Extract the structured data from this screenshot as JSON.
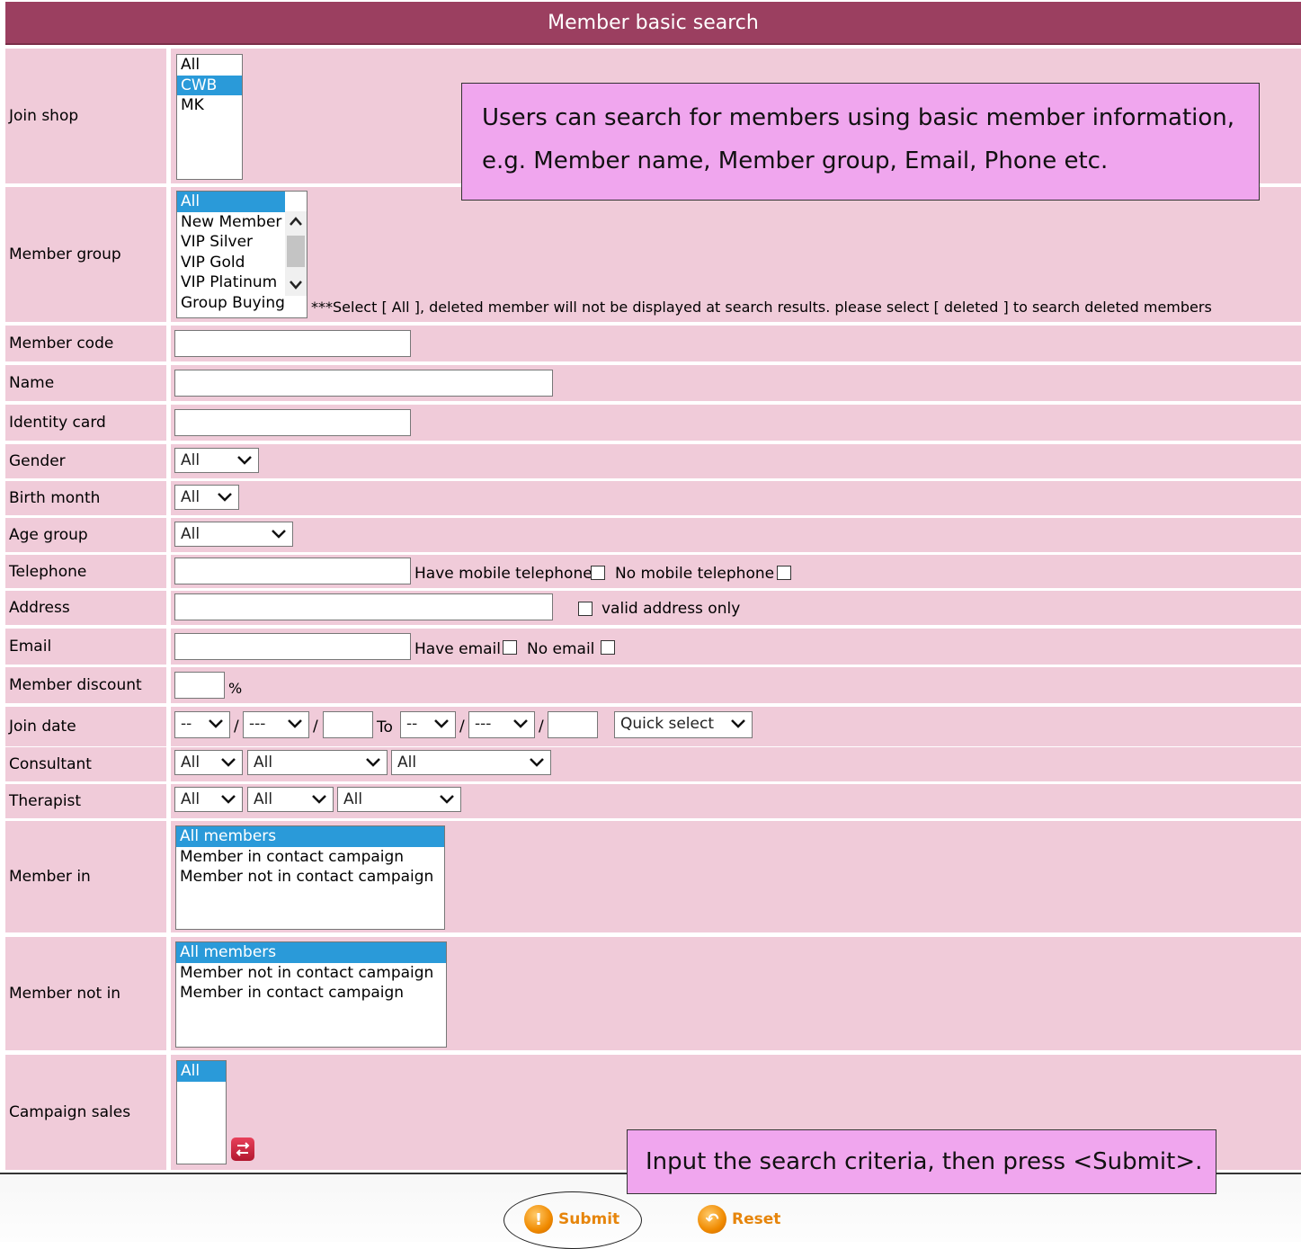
{
  "header": {
    "title": "Member basic search"
  },
  "join_shop": {
    "label": "Join shop",
    "options": [
      "All",
      "CWB",
      "MK"
    ],
    "selected": "CWB"
  },
  "member_group": {
    "label": "Member group",
    "options": [
      "All",
      "New Member",
      "VIP Silver",
      "VIP Gold",
      "VIP Platinum",
      "Group Buying"
    ],
    "selected": "All",
    "note": "***Select [ All ], deleted member will not be displayed at search results. please select [ deleted ] to search deleted members"
  },
  "member_code": {
    "label": "Member code",
    "value": ""
  },
  "name": {
    "label": "Name",
    "value": ""
  },
  "identity_card": {
    "label": "Identity card",
    "value": ""
  },
  "gender": {
    "label": "Gender",
    "value": "All"
  },
  "birth_month": {
    "label": "Birth month",
    "value": "All"
  },
  "age_group": {
    "label": "Age group",
    "value": "All"
  },
  "telephone": {
    "label": "Telephone",
    "value": "",
    "have_mobile": "Have mobile telephone",
    "no_mobile": "No mobile telephone"
  },
  "address": {
    "label": "Address",
    "value": "",
    "valid_only": "valid address only"
  },
  "email": {
    "label": "Email",
    "value": "",
    "have_email": "Have email",
    "no_email": "No email"
  },
  "member_discount": {
    "label": "Member discount",
    "value": "",
    "unit": "%"
  },
  "join_date": {
    "label": "Join date",
    "from_day": "--",
    "from_month": "---",
    "sep": "/",
    "to": "To",
    "to_day": "--",
    "to_month": "---",
    "quick_select": "Quick select"
  },
  "consultant": {
    "label": "Consultant",
    "sel1": "All",
    "sel2": "All",
    "sel3": "All"
  },
  "therapist": {
    "label": "Therapist",
    "sel1": "All",
    "sel2": "All",
    "sel3": "All"
  },
  "member_in": {
    "label": "Member in",
    "options": [
      "All members",
      "Member in contact campaign",
      "Member not in contact campaign"
    ],
    "selected": "All members"
  },
  "member_not_in": {
    "label": "Member not in",
    "options": [
      "All members",
      "Member not in contact campaign",
      "Member in contact campaign"
    ],
    "selected": "All members"
  },
  "campaign_sales": {
    "label": "Campaign sales",
    "options": [
      "All"
    ],
    "selected": "All"
  },
  "callouts": {
    "top_line1": "Users can search for members using basic member information,",
    "top_line2": "e.g. Member name, Member group, Email, Phone etc.",
    "bottom": "Input the search criteria, then press <Submit>."
  },
  "buttons": {
    "submit": "Submit",
    "reset": "Reset",
    "submit_icon": "exclamation-icon",
    "reset_icon": "undo-icon"
  },
  "colors": {
    "header": "#9b3f60",
    "row_bg": "#f0cbd9",
    "selected_option": "#2a9ad9",
    "callout": "#f0a6ee",
    "button_text": "#e6850c"
  }
}
